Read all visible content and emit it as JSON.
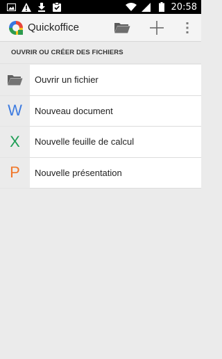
{
  "status_bar": {
    "time": "20:58",
    "icons_left": [
      "image-icon",
      "warning-icon",
      "download-icon",
      "clipboard-check-icon"
    ],
    "icons_right": [
      "wifi-icon",
      "signal-icon",
      "battery-icon"
    ]
  },
  "app_bar": {
    "title": "Quickoffice",
    "actions": [
      "folder-icon",
      "add-icon",
      "overflow-menu-icon"
    ]
  },
  "section": {
    "title": "OUVRIR OU CRÉER DES FICHIERS"
  },
  "items": [
    {
      "label": "Ouvrir un fichier",
      "icon": "folder-icon"
    },
    {
      "label": "Nouveau document",
      "icon": "word-document-icon",
      "letter": "W",
      "color": "#3d7be0"
    },
    {
      "label": "Nouvelle feuille de calcul",
      "icon": "spreadsheet-icon",
      "letter": "X",
      "color": "#1e9e55"
    },
    {
      "label": "Nouvelle présentation",
      "icon": "presentation-icon",
      "letter": "P",
      "color": "#f0772a"
    }
  ],
  "colors": {
    "background": "#ebebeb",
    "list_background": "#ffffff",
    "status_bar": "#000000"
  }
}
